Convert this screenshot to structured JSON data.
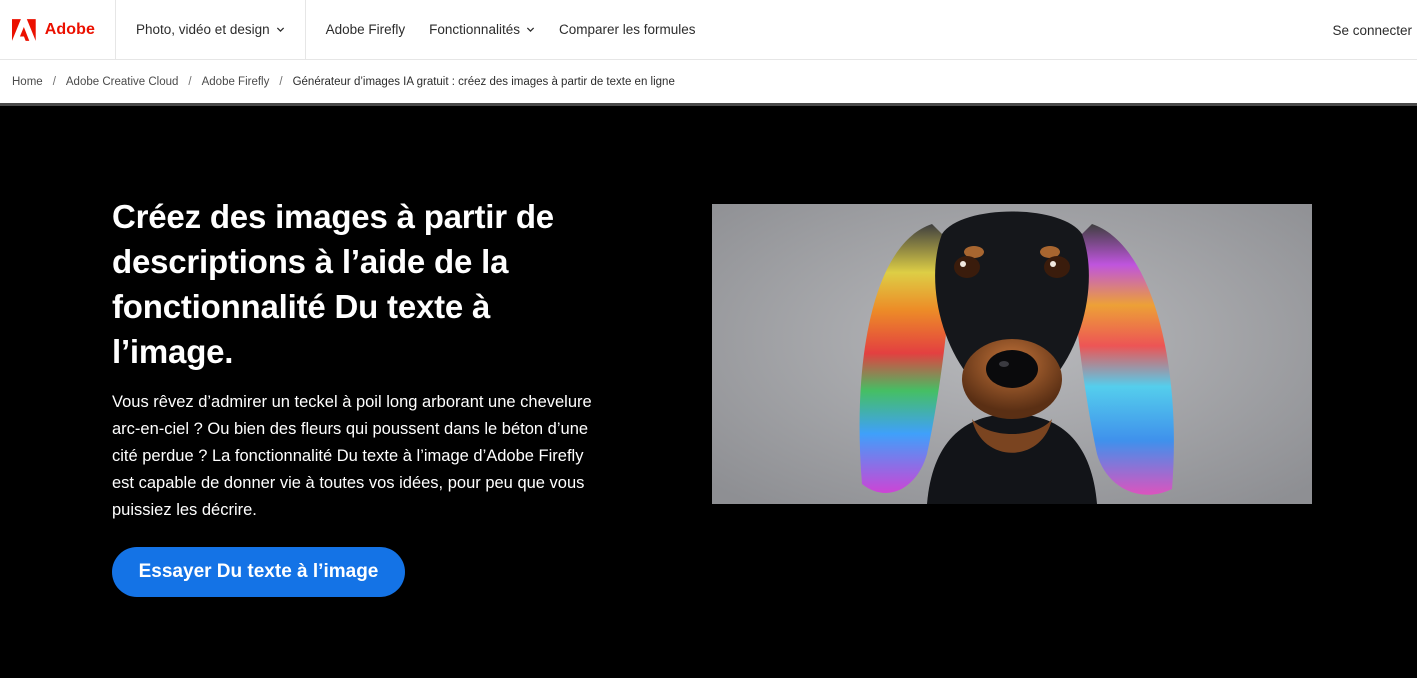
{
  "header": {
    "brand": "Adobe",
    "nav": [
      {
        "label": "Photo, vidéo et design"
      },
      {
        "label": "Adobe Firefly"
      },
      {
        "label": "Fonctionnalités"
      },
      {
        "label": "Comparer les formules"
      }
    ],
    "signin": "Se connecter"
  },
  "breadcrumb": [
    {
      "label": "Home"
    },
    {
      "label": "Adobe Creative Cloud"
    },
    {
      "label": "Adobe Firefly"
    },
    {
      "label": "Générateur d’images IA gratuit : créez des images à partir de texte en ligne"
    }
  ],
  "hero": {
    "title": "Créez des images à partir de descriptions à l’aide de la fonctionnalité Du texte à l’image.",
    "body": "Vous rêvez d’admirer un teckel à poil long arborant une chevelure arc-en-ciel ? Ou bien des fleurs qui poussent dans le béton d’une cité perdue ? La fonctionnalité Du texte à l’image d’Adobe Firefly est capable de donner vie à toutes vos idées, pour peu que vous puissiez les décrire.",
    "cta": "Essayer Du texte à l’image"
  },
  "colors": {
    "brand_red": "#eb1000",
    "cta_blue": "#1473e6",
    "hero_bg": "#000000"
  }
}
